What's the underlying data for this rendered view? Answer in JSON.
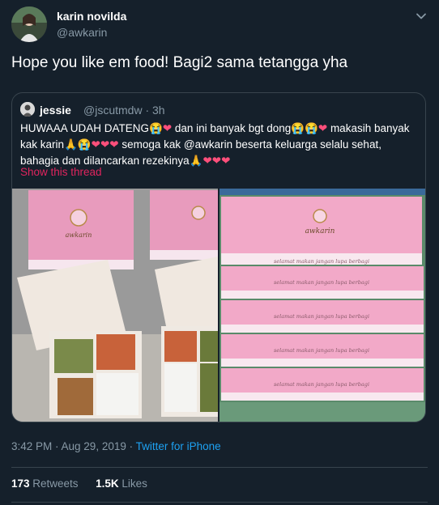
{
  "author": {
    "name": "karin novilda",
    "handle": "@awkarin"
  },
  "tweet_text": "Hope you like em food! Bagi2 sama tetangga yha",
  "quoted": {
    "name": "jessie",
    "meta": "@jscutmdw · 3h",
    "line1_a": "HUWAAA UDAH DATENG😭",
    "line1_b": " dan ini banyak bgt dong😭😭",
    "line1_c": " makasih banyak",
    "line2_a": "kak karin🙏😭",
    "line2_b": " semoga kak @awkarin beserta keluarga selalu sehat,",
    "line3": "bahagia dan dilancarkan rezekinya🙏",
    "heart": "❤",
    "hearts2": "❤❤",
    "hearts3": "❤❤❤",
    "show_thread": "Show this thread",
    "box_brand": "awkarin",
    "box_script": "selamat makan jangan lupa berbagi"
  },
  "timestamp": "3:42 PM · Aug 29, 2019 · ",
  "source": "Twitter for iPhone",
  "stats": {
    "retweets_count": "173",
    "retweets_label": " Retweets",
    "likes_count": "1.5K",
    "likes_label": " Likes"
  },
  "colors": {
    "background": "#15202b",
    "accent": "#1da1f2",
    "secondary_text": "#8899a6",
    "show_thread": "#e0245e",
    "heart": "#ff4f7b",
    "box_pink": "#f2a9c8"
  },
  "icons": [
    "chevron-down-icon"
  ]
}
